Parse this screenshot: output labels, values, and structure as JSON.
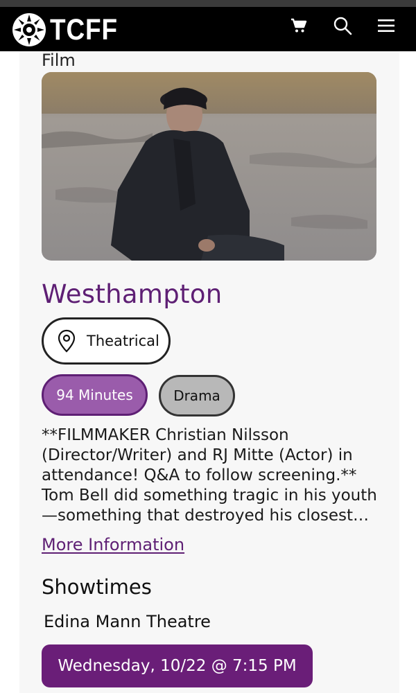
{
  "header": {
    "logo_text": "TCFF",
    "brand_color": "#000000",
    "icons": [
      "film-reel-logo-icon",
      "cart-icon",
      "search-icon",
      "menu-icon"
    ]
  },
  "breadcrumb": "Film",
  "film": {
    "title": "Westhampton",
    "venue_type": "Theatrical",
    "runtime": "94 Minutes",
    "genre": "Drama",
    "description_lines": [
      "**FILMMAKER Christian Nilsson",
      "(Director/Writer) and RJ Mitte (Actor) in",
      "attendance! Q&A to follow screening.**",
      "Tom Bell did something tragic in his youth",
      "—something that destroyed his closest…"
    ],
    "more_info_label": "More Information"
  },
  "showtimes": {
    "heading": "Showtimes",
    "theatre": "Edina Mann Theatre",
    "times": [
      "Wednesday, 10/22 @ 7:15 PM"
    ]
  },
  "colors": {
    "accent": "#5e1f74",
    "runtime_pill": "#9a5cab",
    "genre_pill": "#b8b8b8",
    "showtime_button": "#6a1e78"
  }
}
